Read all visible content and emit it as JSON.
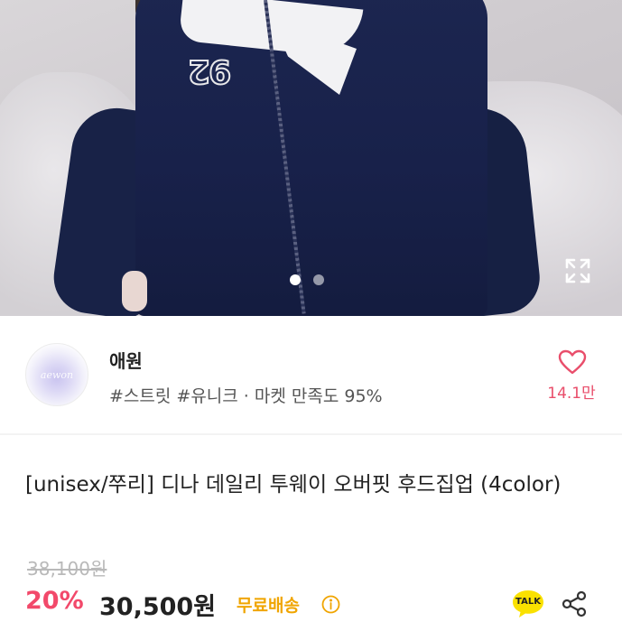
{
  "gallery": {
    "image_description": "navy zip-up hoodie worn by model",
    "print_text": "92",
    "dots": [
      {
        "active": true
      },
      {
        "active": false
      }
    ],
    "expand_icon": "expand-icon"
  },
  "shop": {
    "name": "애원",
    "tags": "#스트릿 #유니크 · 마켓 만족도 95%",
    "likes": "14.1만",
    "heart_icon": "heart-outline-icon",
    "heart_color": "#e94e6b"
  },
  "product": {
    "title": "[unisex/쭈리] 디나 데일리 투웨이 오버핏 후드집업 (4color)",
    "original_price": "38,100원",
    "discount": "20%",
    "price": "30,500원",
    "shipping": "무료배송",
    "discount_color": "#f2496a",
    "shipping_color": "#f0a500"
  },
  "actions": {
    "talk_label": "TALK",
    "talk_color": "#fae100",
    "share_icon": "share-icon"
  }
}
